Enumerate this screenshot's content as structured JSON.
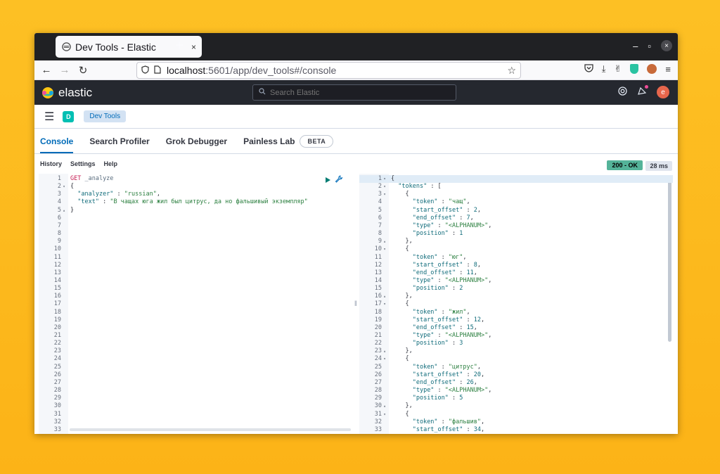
{
  "browser": {
    "tab_title": "Dev Tools - Elastic",
    "tab_close": "×",
    "new_tab": "+",
    "url_host": "localhost",
    "url_path": ":5601/app/dev_tools#/console",
    "win_minimize": "–",
    "win_maximize": "▫",
    "win_close": "×"
  },
  "kibana": {
    "brand": "elastic",
    "search_placeholder": "Search Elastic",
    "user_initial": "e",
    "space_initial": "D",
    "breadcrumb": "Dev Tools"
  },
  "tabs": [
    {
      "label": "Console"
    },
    {
      "label": "Search Profiler"
    },
    {
      "label": "Grok Debugger"
    },
    {
      "label": "Painless Lab"
    }
  ],
  "beta_label": "BETA",
  "console_menu": [
    "History",
    "Settings",
    "Help"
  ],
  "response_status": {
    "code_text": "200 - OK",
    "time_text": "28 ms"
  },
  "request_lines": [
    [
      {
        "t": "GET",
        "c": "method"
      },
      {
        "t": " _analyze",
        "c": "url"
      }
    ],
    [
      {
        "t": "{",
        "c": "punc"
      }
    ],
    [
      {
        "t": "  ",
        "c": "punc"
      },
      {
        "t": "\"analyzer\"",
        "c": "key"
      },
      {
        "t": " : ",
        "c": "punc"
      },
      {
        "t": "\"russian\"",
        "c": "str"
      },
      {
        "t": ",",
        "c": "punc"
      }
    ],
    [
      {
        "t": "  ",
        "c": "punc"
      },
      {
        "t": "\"text\"",
        "c": "key"
      },
      {
        "t": " : ",
        "c": "punc"
      },
      {
        "t": "\"В чащах юга жил был цитрус, да но фальшивый экземпляр\"",
        "c": "str"
      }
    ],
    [
      {
        "t": "}",
        "c": "punc"
      }
    ]
  ],
  "request_folds": [
    "",
    "▾",
    "",
    "",
    "▴"
  ],
  "request_total_lines": 33,
  "response_lines": [
    [
      {
        "t": "{",
        "c": "punc"
      }
    ],
    [
      {
        "t": "  ",
        "c": "punc"
      },
      {
        "t": "\"tokens\"",
        "c": "key"
      },
      {
        "t": " : [",
        "c": "punc"
      }
    ],
    [
      {
        "t": "    {",
        "c": "punc"
      }
    ],
    [
      {
        "t": "      ",
        "c": "punc"
      },
      {
        "t": "\"token\"",
        "c": "key"
      },
      {
        "t": " : ",
        "c": "punc"
      },
      {
        "t": "\"чащ\"",
        "c": "str"
      },
      {
        "t": ",",
        "c": "punc"
      }
    ],
    [
      {
        "t": "      ",
        "c": "punc"
      },
      {
        "t": "\"start_offset\"",
        "c": "key"
      },
      {
        "t": " : ",
        "c": "punc"
      },
      {
        "t": "2",
        "c": "num"
      },
      {
        "t": ",",
        "c": "punc"
      }
    ],
    [
      {
        "t": "      ",
        "c": "punc"
      },
      {
        "t": "\"end_offset\"",
        "c": "key"
      },
      {
        "t": " : ",
        "c": "punc"
      },
      {
        "t": "7",
        "c": "num"
      },
      {
        "t": ",",
        "c": "punc"
      }
    ],
    [
      {
        "t": "      ",
        "c": "punc"
      },
      {
        "t": "\"type\"",
        "c": "key"
      },
      {
        "t": " : ",
        "c": "punc"
      },
      {
        "t": "\"<ALPHANUM>\"",
        "c": "str"
      },
      {
        "t": ",",
        "c": "punc"
      }
    ],
    [
      {
        "t": "      ",
        "c": "punc"
      },
      {
        "t": "\"position\"",
        "c": "key"
      },
      {
        "t": " : ",
        "c": "punc"
      },
      {
        "t": "1",
        "c": "num"
      }
    ],
    [
      {
        "t": "    },",
        "c": "punc"
      }
    ],
    [
      {
        "t": "    {",
        "c": "punc"
      }
    ],
    [
      {
        "t": "      ",
        "c": "punc"
      },
      {
        "t": "\"token\"",
        "c": "key"
      },
      {
        "t": " : ",
        "c": "punc"
      },
      {
        "t": "\"юг\"",
        "c": "str"
      },
      {
        "t": ",",
        "c": "punc"
      }
    ],
    [
      {
        "t": "      ",
        "c": "punc"
      },
      {
        "t": "\"start_offset\"",
        "c": "key"
      },
      {
        "t": " : ",
        "c": "punc"
      },
      {
        "t": "8",
        "c": "num"
      },
      {
        "t": ",",
        "c": "punc"
      }
    ],
    [
      {
        "t": "      ",
        "c": "punc"
      },
      {
        "t": "\"end_offset\"",
        "c": "key"
      },
      {
        "t": " : ",
        "c": "punc"
      },
      {
        "t": "11",
        "c": "num"
      },
      {
        "t": ",",
        "c": "punc"
      }
    ],
    [
      {
        "t": "      ",
        "c": "punc"
      },
      {
        "t": "\"type\"",
        "c": "key"
      },
      {
        "t": " : ",
        "c": "punc"
      },
      {
        "t": "\"<ALPHANUM>\"",
        "c": "str"
      },
      {
        "t": ",",
        "c": "punc"
      }
    ],
    [
      {
        "t": "      ",
        "c": "punc"
      },
      {
        "t": "\"position\"",
        "c": "key"
      },
      {
        "t": " : ",
        "c": "punc"
      },
      {
        "t": "2",
        "c": "num"
      }
    ],
    [
      {
        "t": "    },",
        "c": "punc"
      }
    ],
    [
      {
        "t": "    {",
        "c": "punc"
      }
    ],
    [
      {
        "t": "      ",
        "c": "punc"
      },
      {
        "t": "\"token\"",
        "c": "key"
      },
      {
        "t": " : ",
        "c": "punc"
      },
      {
        "t": "\"жил\"",
        "c": "str"
      },
      {
        "t": ",",
        "c": "punc"
      }
    ],
    [
      {
        "t": "      ",
        "c": "punc"
      },
      {
        "t": "\"start_offset\"",
        "c": "key"
      },
      {
        "t": " : ",
        "c": "punc"
      },
      {
        "t": "12",
        "c": "num"
      },
      {
        "t": ",",
        "c": "punc"
      }
    ],
    [
      {
        "t": "      ",
        "c": "punc"
      },
      {
        "t": "\"end_offset\"",
        "c": "key"
      },
      {
        "t": " : ",
        "c": "punc"
      },
      {
        "t": "15",
        "c": "num"
      },
      {
        "t": ",",
        "c": "punc"
      }
    ],
    [
      {
        "t": "      ",
        "c": "punc"
      },
      {
        "t": "\"type\"",
        "c": "key"
      },
      {
        "t": " : ",
        "c": "punc"
      },
      {
        "t": "\"<ALPHANUM>\"",
        "c": "str"
      },
      {
        "t": ",",
        "c": "punc"
      }
    ],
    [
      {
        "t": "      ",
        "c": "punc"
      },
      {
        "t": "\"position\"",
        "c": "key"
      },
      {
        "t": " : ",
        "c": "punc"
      },
      {
        "t": "3",
        "c": "num"
      }
    ],
    [
      {
        "t": "    },",
        "c": "punc"
      }
    ],
    [
      {
        "t": "    {",
        "c": "punc"
      }
    ],
    [
      {
        "t": "      ",
        "c": "punc"
      },
      {
        "t": "\"token\"",
        "c": "key"
      },
      {
        "t": " : ",
        "c": "punc"
      },
      {
        "t": "\"цитрус\"",
        "c": "str"
      },
      {
        "t": ",",
        "c": "punc"
      }
    ],
    [
      {
        "t": "      ",
        "c": "punc"
      },
      {
        "t": "\"start_offset\"",
        "c": "key"
      },
      {
        "t": " : ",
        "c": "punc"
      },
      {
        "t": "20",
        "c": "num"
      },
      {
        "t": ",",
        "c": "punc"
      }
    ],
    [
      {
        "t": "      ",
        "c": "punc"
      },
      {
        "t": "\"end_offset\"",
        "c": "key"
      },
      {
        "t": " : ",
        "c": "punc"
      },
      {
        "t": "26",
        "c": "num"
      },
      {
        "t": ",",
        "c": "punc"
      }
    ],
    [
      {
        "t": "      ",
        "c": "punc"
      },
      {
        "t": "\"type\"",
        "c": "key"
      },
      {
        "t": " : ",
        "c": "punc"
      },
      {
        "t": "\"<ALPHANUM>\"",
        "c": "str"
      },
      {
        "t": ",",
        "c": "punc"
      }
    ],
    [
      {
        "t": "      ",
        "c": "punc"
      },
      {
        "t": "\"position\"",
        "c": "key"
      },
      {
        "t": " : ",
        "c": "punc"
      },
      {
        "t": "5",
        "c": "num"
      }
    ],
    [
      {
        "t": "    },",
        "c": "punc"
      }
    ],
    [
      {
        "t": "    {",
        "c": "punc"
      }
    ],
    [
      {
        "t": "      ",
        "c": "punc"
      },
      {
        "t": "\"token\"",
        "c": "key"
      },
      {
        "t": " : ",
        "c": "punc"
      },
      {
        "t": "\"фальшив\"",
        "c": "str"
      },
      {
        "t": ",",
        "c": "punc"
      }
    ],
    [
      {
        "t": "      ",
        "c": "punc"
      },
      {
        "t": "\"start_offset\"",
        "c": "key"
      },
      {
        "t": " : ",
        "c": "punc"
      },
      {
        "t": "34",
        "c": "num"
      },
      {
        "t": ",",
        "c": "punc"
      }
    ]
  ],
  "response_folds": [
    "▾",
    "▾",
    "▾",
    "",
    "",
    "",
    "",
    "",
    "▴",
    "▾",
    "",
    "",
    "",
    "",
    "",
    "▴",
    "▾",
    "",
    "",
    "",
    "",
    "",
    "▴",
    "▾",
    "",
    "",
    "",
    "",
    "",
    "▴",
    "▾",
    "",
    ""
  ],
  "icons": {
    "play": "play-icon",
    "wrench": "wrench-icon",
    "split": "‖"
  },
  "colors": {
    "accent": "#006bb8",
    "status_ok": "#54b399",
    "header_bg": "#25282f"
  }
}
